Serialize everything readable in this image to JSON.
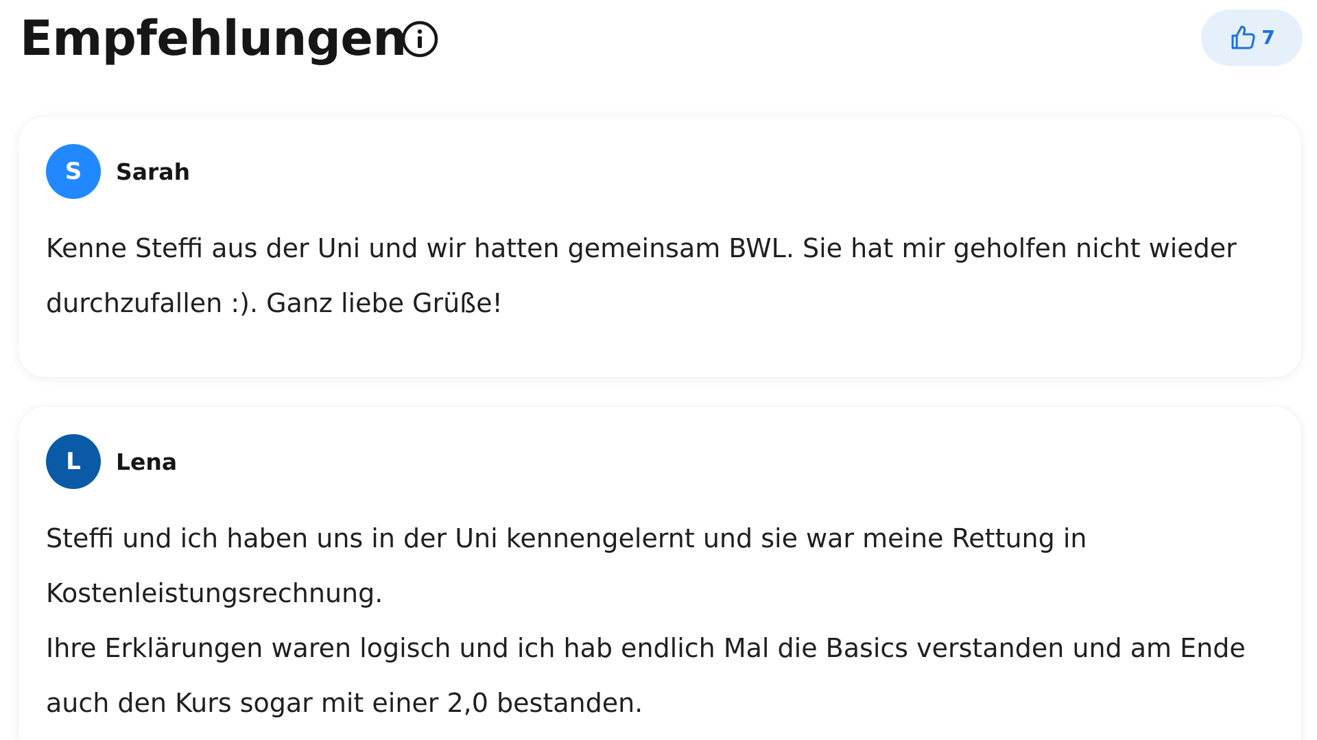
{
  "header": {
    "title": "Empfehlungen",
    "info_icon": "info-circle-icon",
    "like_icon": "thumbs-up-icon",
    "like_count": "7"
  },
  "colors": {
    "like_button_bg": "#e5f0fb",
    "accent_blue": "#1d6fe0",
    "avatar_sarah": "#2188ff",
    "avatar_lena": "#0a5aa8"
  },
  "reviews": [
    {
      "initial": "S",
      "name": "Sarah",
      "text": "Kenne Steffi aus der Uni und wir hatten gemeinsam BWL. Sie hat mir geholfen nicht wieder durchzufallen :). Ganz liebe Grüße!"
    },
    {
      "initial": "L",
      "name": "Lena",
      "text": "Steffi und ich haben uns in der Uni kennengelernt und sie war meine Rettung in Kostenleistungsrechnung.\nIhre Erklärungen waren logisch und ich hab endlich Mal die Basics verstanden und am Ende auch den Kurs sogar mit einer 2,0 bestanden."
    }
  ]
}
